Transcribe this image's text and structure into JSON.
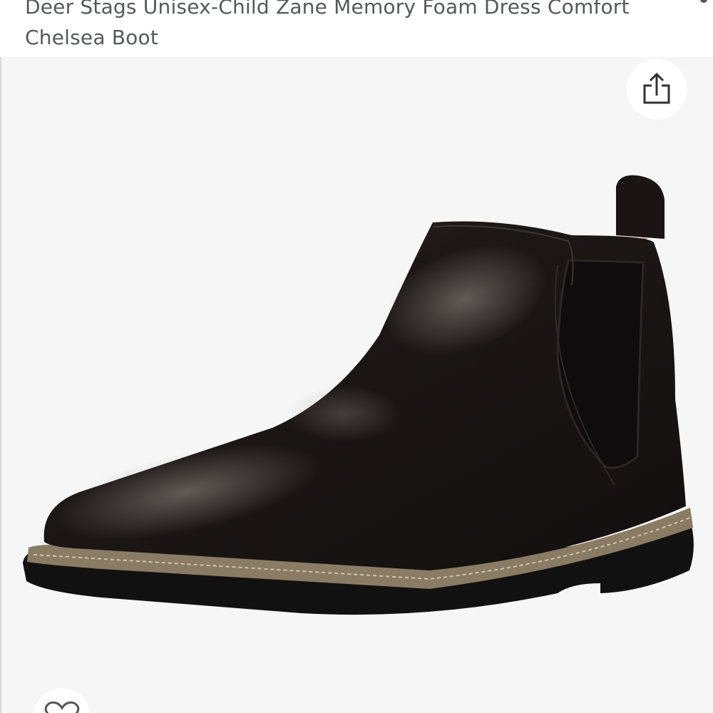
{
  "product": {
    "title": "Deer Stags Unisex-Child Zane Memory Foam Dress Comfort Chelsea Boot"
  },
  "actions": {
    "share_icon": "share-icon",
    "wishlist_icon": "heart-icon"
  },
  "colors": {
    "title_text": "#565959",
    "image_background": "#f6f6f6",
    "boot_leather": "#1c1716",
    "boot_welt": "#8a7b64",
    "boot_lining": "#a0643a"
  }
}
